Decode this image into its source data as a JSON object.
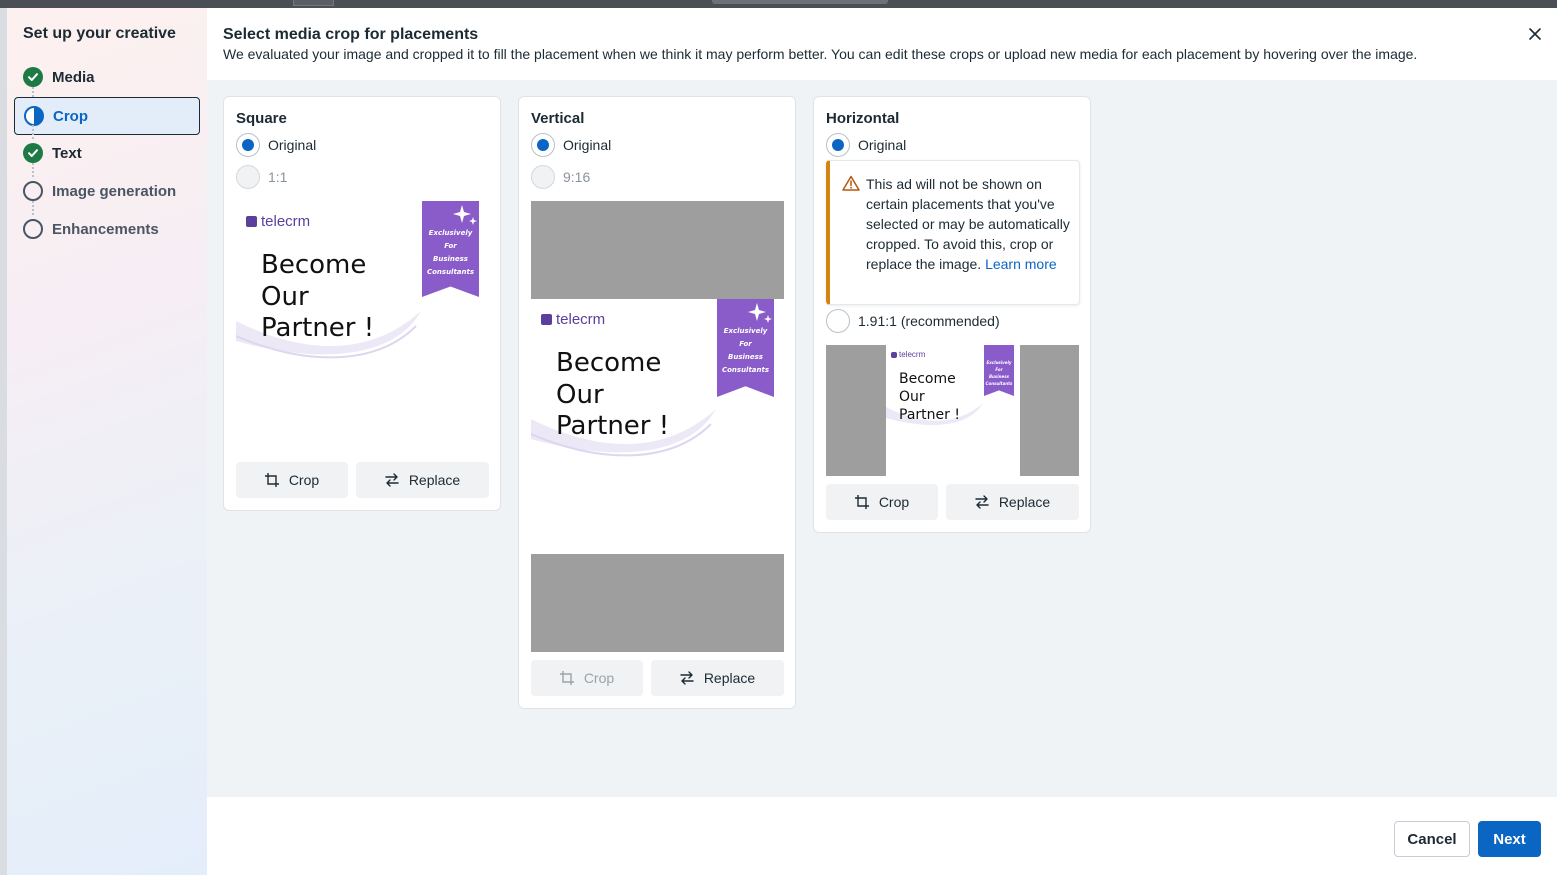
{
  "sidebar": {
    "title": "Set up your creative",
    "steps": [
      {
        "label": "Media",
        "status": "done"
      },
      {
        "label": "Crop",
        "status": "active"
      },
      {
        "label": "Text",
        "status": "done"
      },
      {
        "label": "Image generation",
        "status": "pending"
      },
      {
        "label": "Enhancements",
        "status": "pending"
      }
    ]
  },
  "header": {
    "title": "Select media crop for placements",
    "description": "We evaluated your image and cropped it to fill the placement when we think it may perform better. You can edit these crops or upload new media for each placement by hovering over the image."
  },
  "creative": {
    "logo": "telecrm",
    "headline": [
      "Become",
      "Our",
      "Partner !"
    ],
    "ribbon": [
      "Exclusively",
      "For",
      "Business",
      "Consultants"
    ]
  },
  "cards": {
    "square": {
      "title": "Square",
      "option1": "Original",
      "option2": "1:1",
      "crop": "Crop",
      "replace": "Replace"
    },
    "vertical": {
      "title": "Vertical",
      "option1": "Original",
      "option2": "9:16",
      "crop": "Crop",
      "replace": "Replace"
    },
    "horizontal": {
      "title": "Horizontal",
      "option1": "Original",
      "warning_text": "This ad will not be shown on certain placements that you've selected or may be automatically cropped. To avoid this, crop or replace the image.",
      "warning_link": "Learn more",
      "option2": "1.91:1 (recommended)",
      "crop": "Crop",
      "replace": "Replace"
    }
  },
  "footer": {
    "cancel": "Cancel",
    "next": "Next"
  },
  "colors": {
    "primary": "#0a66c2",
    "done": "#1e7a45",
    "warning": "#d4840f",
    "ribbon": "#8a5cc9",
    "logo": "#5b3f9c"
  }
}
